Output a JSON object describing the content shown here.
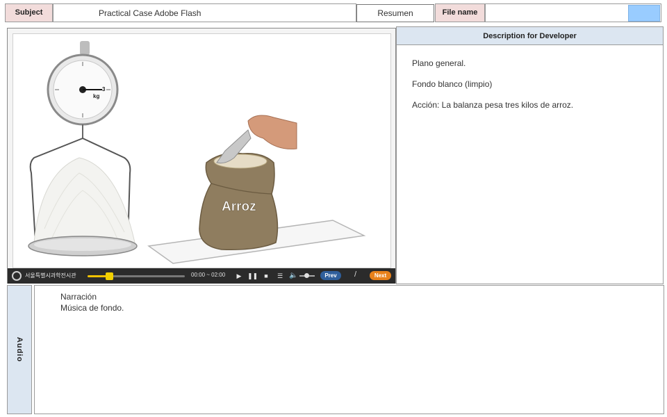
{
  "header": {
    "subject_label": "Subject",
    "subject_value": "Practical Case Adobe Flash",
    "resumen": "Resumen",
    "file_name_label": "File name",
    "file_name_value": "",
    "swatch_color": "#99ccff"
  },
  "media": {
    "scale_unit": "kg",
    "scale_reading": "3",
    "sack_label": "Arroz",
    "player": {
      "brand": "서울특별시과학전시관",
      "time": "00:00 ~ 02:00",
      "progress": 0.22,
      "volume": 0.45,
      "prev_label": "Prev",
      "separator": "/",
      "next_label": "Next",
      "icons": [
        "play-icon",
        "pause-icon",
        "stop-icon",
        "menu-icon",
        "volume-icon"
      ]
    }
  },
  "description": {
    "header": "Description for Developer",
    "lines": [
      "Plano general.",
      "Fondo blanco (limpio)",
      "Acción: La balanza pesa tres kilos de arroz."
    ]
  },
  "audio": {
    "label": "Audio",
    "lines": [
      "Narración",
      "Música de fondo."
    ]
  }
}
